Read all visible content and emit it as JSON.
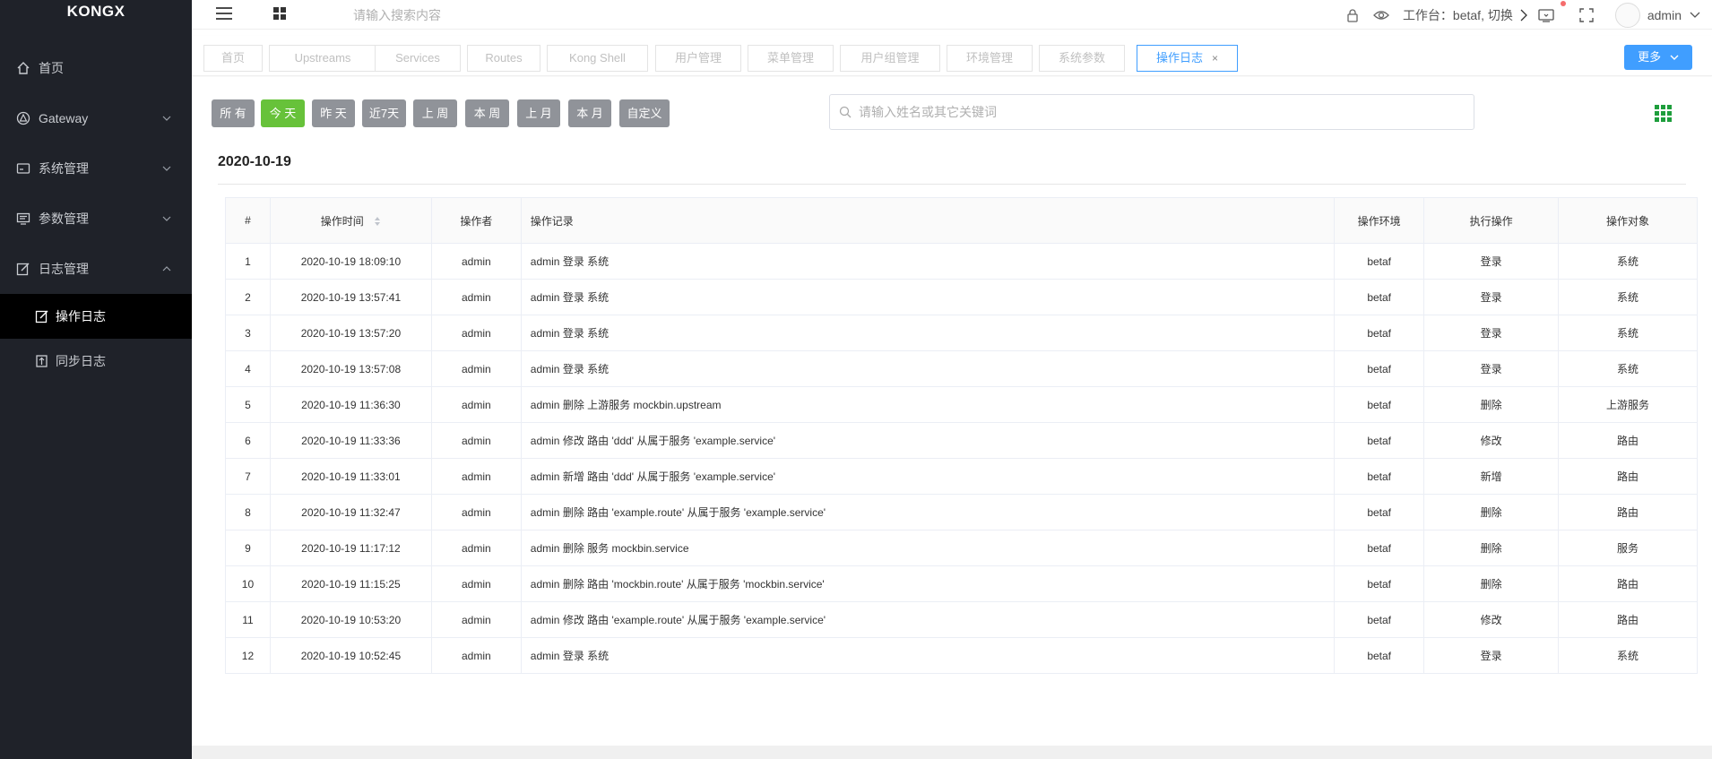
{
  "app": {
    "logo": "KONGX"
  },
  "sidebar": {
    "items": [
      {
        "label": "首页",
        "icon": "home-icon"
      },
      {
        "label": "Gateway",
        "icon": "gateway-icon",
        "expandable": true
      },
      {
        "label": "系统管理",
        "icon": "system-icon",
        "expandable": true
      },
      {
        "label": "参数管理",
        "icon": "params-icon",
        "expandable": true
      },
      {
        "label": "日志管理",
        "icon": "log-icon",
        "expandable": true,
        "expanded": true
      }
    ],
    "sub_items": [
      {
        "label": "操作日志",
        "icon": "edit-icon",
        "active": true
      },
      {
        "label": "同步日志",
        "icon": "sync-icon"
      }
    ]
  },
  "header": {
    "search_placeholder": "请输入搜索内容",
    "workspace_text": "工作台：betaf, 切换",
    "user": "admin"
  },
  "tabs": [
    {
      "label": "首页"
    },
    {
      "label": "Upstreams"
    },
    {
      "label": "Services"
    },
    {
      "label": "Routes"
    },
    {
      "label": "Kong Shell"
    },
    {
      "label": "用户管理"
    },
    {
      "label": "菜单管理"
    },
    {
      "label": "用户组管理"
    },
    {
      "label": "环境管理"
    },
    {
      "label": "系统参数"
    },
    {
      "label": "操作日志",
      "active": true
    }
  ],
  "more_label": "更多",
  "filters": [
    {
      "label": "所 有"
    },
    {
      "label": "今 天",
      "active": true
    },
    {
      "label": "昨 天"
    },
    {
      "label": "近7天"
    },
    {
      "label": "上 周"
    },
    {
      "label": "本 周"
    },
    {
      "label": "上 月"
    },
    {
      "label": "本 月"
    },
    {
      "label": "自定义"
    }
  ],
  "filter_search_placeholder": "请输入姓名或其它关键词",
  "date_title": "2020-10-19",
  "colors": {
    "accent": "#409eff",
    "active_filter": "#67c23a",
    "sidebar_bg": "#1f2229",
    "grid_icon": "#1e9e3c"
  },
  "table": {
    "headers": [
      "#",
      "操作时间",
      "操作者",
      "操作记录",
      "操作环境",
      "执行操作",
      "操作对象"
    ],
    "rows": [
      [
        "1",
        "2020-10-19 18:09:10",
        "admin",
        "admin 登录 系统",
        "betaf",
        "登录",
        "系统"
      ],
      [
        "2",
        "2020-10-19 13:57:41",
        "admin",
        "admin 登录 系统",
        "betaf",
        "登录",
        "系统"
      ],
      [
        "3",
        "2020-10-19 13:57:20",
        "admin",
        "admin 登录 系统",
        "betaf",
        "登录",
        "系统"
      ],
      [
        "4",
        "2020-10-19 13:57:08",
        "admin",
        "admin 登录 系统",
        "betaf",
        "登录",
        "系统"
      ],
      [
        "5",
        "2020-10-19 11:36:30",
        "admin",
        "admin 删除 上游服务 mockbin.upstream",
        "betaf",
        "删除",
        "上游服务"
      ],
      [
        "6",
        "2020-10-19 11:33:36",
        "admin",
        "admin 修改 路由 'ddd' 从属于服务 'example.service'",
        "betaf",
        "修改",
        "路由"
      ],
      [
        "7",
        "2020-10-19 11:33:01",
        "admin",
        "admin 新增 路由 'ddd' 从属于服务 'example.service'",
        "betaf",
        "新增",
        "路由"
      ],
      [
        "8",
        "2020-10-19 11:32:47",
        "admin",
        "admin 删除 路由 'example.route' 从属于服务 'example.service'",
        "betaf",
        "删除",
        "路由"
      ],
      [
        "9",
        "2020-10-19 11:17:12",
        "admin",
        "admin 删除 服务 mockbin.service",
        "betaf",
        "删除",
        "服务"
      ],
      [
        "10",
        "2020-10-19 11:15:25",
        "admin",
        "admin 删除 路由 'mockbin.route' 从属于服务 'mockbin.service'",
        "betaf",
        "删除",
        "路由"
      ],
      [
        "11",
        "2020-10-19 10:53:20",
        "admin",
        "admin 修改 路由 'example.route' 从属于服务 'example.service'",
        "betaf",
        "修改",
        "路由"
      ],
      [
        "12",
        "2020-10-19 10:52:45",
        "admin",
        "admin 登录 系统",
        "betaf",
        "登录",
        "系统"
      ]
    ]
  }
}
